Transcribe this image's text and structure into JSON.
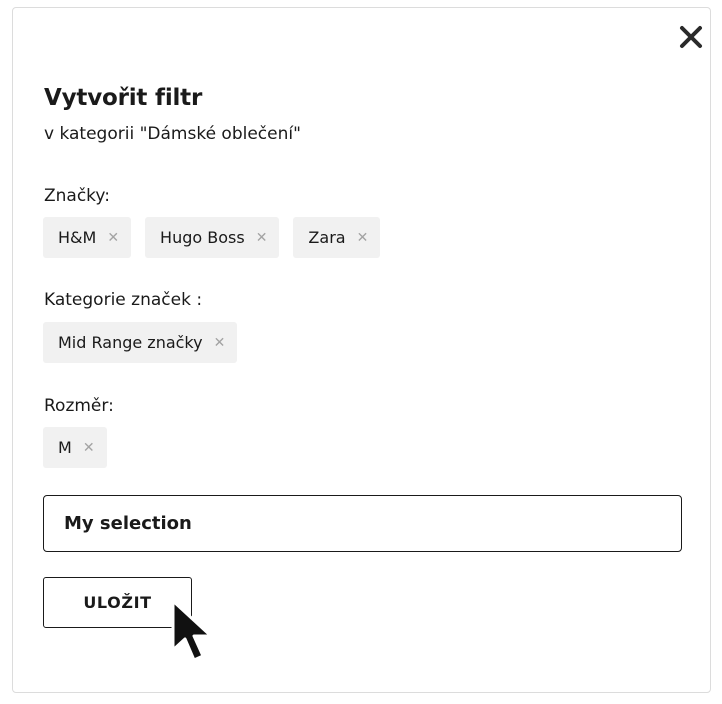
{
  "dialog": {
    "title": "Vytvořit filtr",
    "subtitle": "v kategorii \"Dámské oblečení\"",
    "close_icon": "close-icon"
  },
  "filters": {
    "brands": {
      "label": "Značky:",
      "chips": [
        "H&M",
        "Hugo Boss",
        "Zara"
      ]
    },
    "brand_categories": {
      "label": "Kategorie značek :",
      "chips": [
        "Mid Range značky"
      ]
    },
    "size": {
      "label": "Rozměr:",
      "chips": [
        "M"
      ]
    }
  },
  "name_input": {
    "value": "My selection"
  },
  "save_button": {
    "label": "ULOŽIT"
  },
  "colors": {
    "text": "#1a1a1a",
    "chip_bg": "#f1f1f1",
    "chip_remove": "#a3a3a3",
    "border": "#dcdcdc"
  }
}
